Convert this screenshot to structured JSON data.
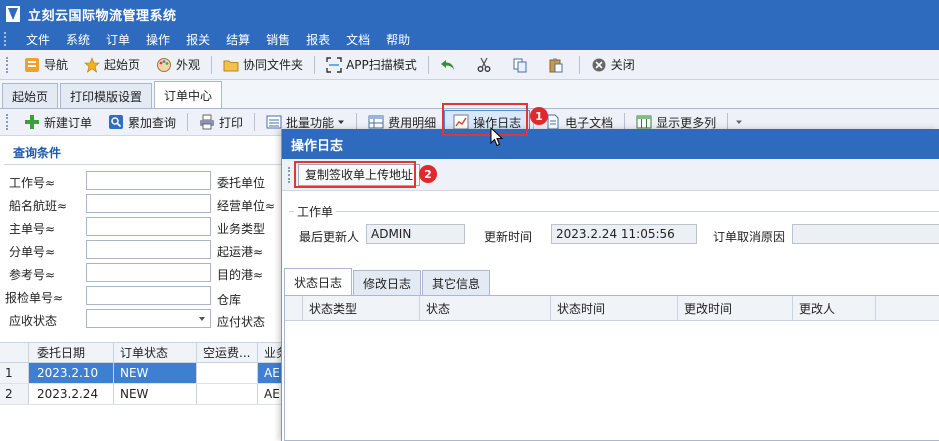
{
  "window": {
    "title": "立刻云国际物流管理系统"
  },
  "menu": [
    "文件",
    "系统",
    "订单",
    "操作",
    "报关",
    "结算",
    "销售",
    "报表",
    "文档",
    "帮助"
  ],
  "toolbar1": {
    "nav": "导航",
    "home": "起始页",
    "external": "外观",
    "collab": "协同文件夹",
    "app_scan": "APP扫描模式",
    "close": "关闭"
  },
  "tabs": [
    "起始页",
    "打印模版设置",
    "订单中心"
  ],
  "toolbar2": {
    "new_order": "新建订单",
    "cumulative_query": "累加查询",
    "print": "打印",
    "batch": "批量功能",
    "fee_detail": "费用明细",
    "op_log": "操作日志",
    "e_doc": "电子文档",
    "show_more": "显示更多列"
  },
  "query": {
    "title": "查询条件",
    "labels": [
      "工作号≈",
      "船名航班≈",
      "主单号≈",
      "分单号≈",
      "参考号≈",
      "报检单号≈",
      "应收状态"
    ],
    "labels2": [
      "委托单位",
      "经营单位≈",
      "业务类型",
      "起运港≈",
      "目的港≈",
      "仓库",
      "应付状态"
    ]
  },
  "grid": {
    "columns": [
      "委托日期",
      "订单状态",
      "空运费...",
      "业务"
    ],
    "rows": [
      {
        "num": "1",
        "date": "2023.2.10",
        "status": "NEW",
        "air": "",
        "biz": "AE"
      },
      {
        "num": "2",
        "date": "2023.2.24",
        "status": "NEW",
        "air": "",
        "biz": "AE"
      }
    ]
  },
  "dialog": {
    "title": "操作日志",
    "copy_btn": "复制签收单上传地址",
    "legend": "工作单",
    "last_updater_label": "最后更新人",
    "last_updater": "ADMIN",
    "update_time_label": "更新时间",
    "update_time": "2023.2.24 11:05:56",
    "cancel_reason_label": "订单取消原因",
    "cancel_reason": "",
    "sub_tabs": [
      "状态日志",
      "修改日志",
      "其它信息"
    ],
    "columns": [
      "状态类型",
      "状态",
      "状态时间",
      "更改时间",
      "更改人"
    ]
  },
  "annotations": [
    "1",
    "2"
  ],
  "colors": {
    "title_bar": "#2e6bbf",
    "highlight": "#e23636",
    "selection": "#3d7fd1"
  }
}
